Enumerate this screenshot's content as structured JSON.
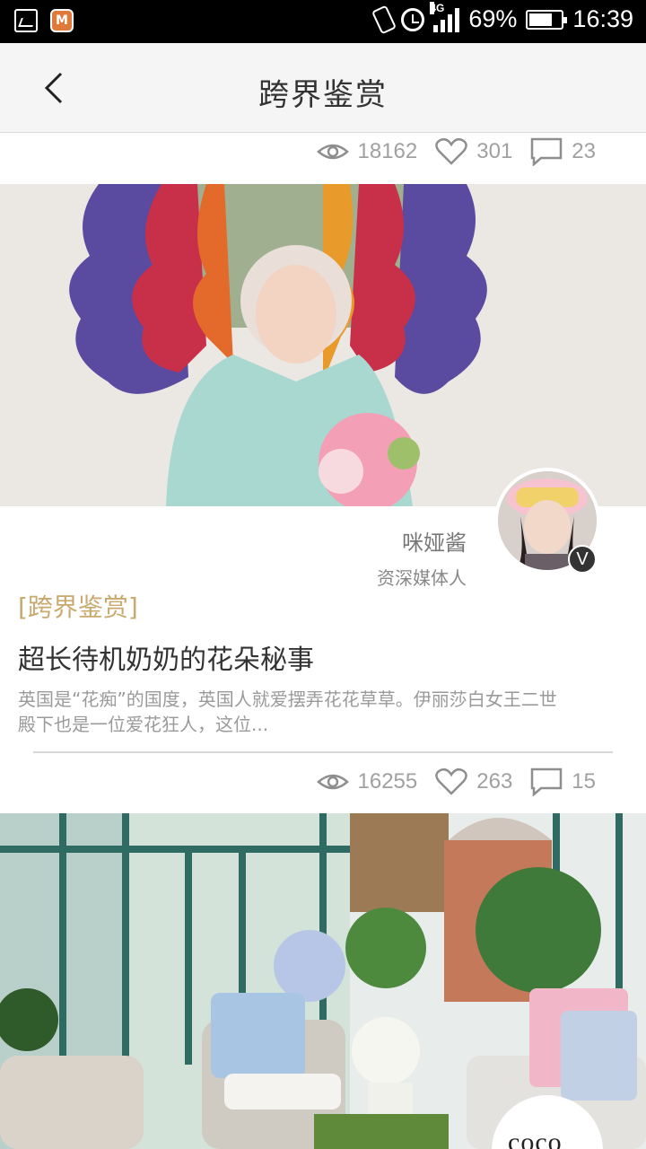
{
  "status_bar": {
    "battery_percent": "69%",
    "battery_level": 0.69,
    "time": "16:39",
    "network": "4G",
    "icons": [
      "gallery-icon",
      "app-icon",
      "vibrate-icon",
      "alarm-icon",
      "signal-icon",
      "battery-icon"
    ]
  },
  "header": {
    "title": "跨界鉴赏",
    "back_icon": "chevron-left-icon"
  },
  "feed": [
    {
      "stats": {
        "views": "18162",
        "likes": "301",
        "comments": "23"
      }
    },
    {
      "image_desc_icon": "article-cover-image",
      "author": {
        "name": "咪娅酱",
        "title": "资深媒体人",
        "badge": "V"
      },
      "category": "[跨界鉴赏]",
      "title": "超长待机奶奶的花朵秘事",
      "summary": "英国是“花痴”的国度，英国人就爱摆弄花花草草。伊丽莎白女王二世殿下也是一位爱花狂人，这位...",
      "stats": {
        "views": "16255",
        "likes": "263",
        "comments": "15"
      }
    },
    {
      "image_desc_icon": "article-cover-image",
      "brand": "coco"
    }
  ],
  "colors": {
    "accent": "#c9a96e",
    "stat_gray": "#a0a0a0",
    "header_bg": "#f5f5f5"
  }
}
